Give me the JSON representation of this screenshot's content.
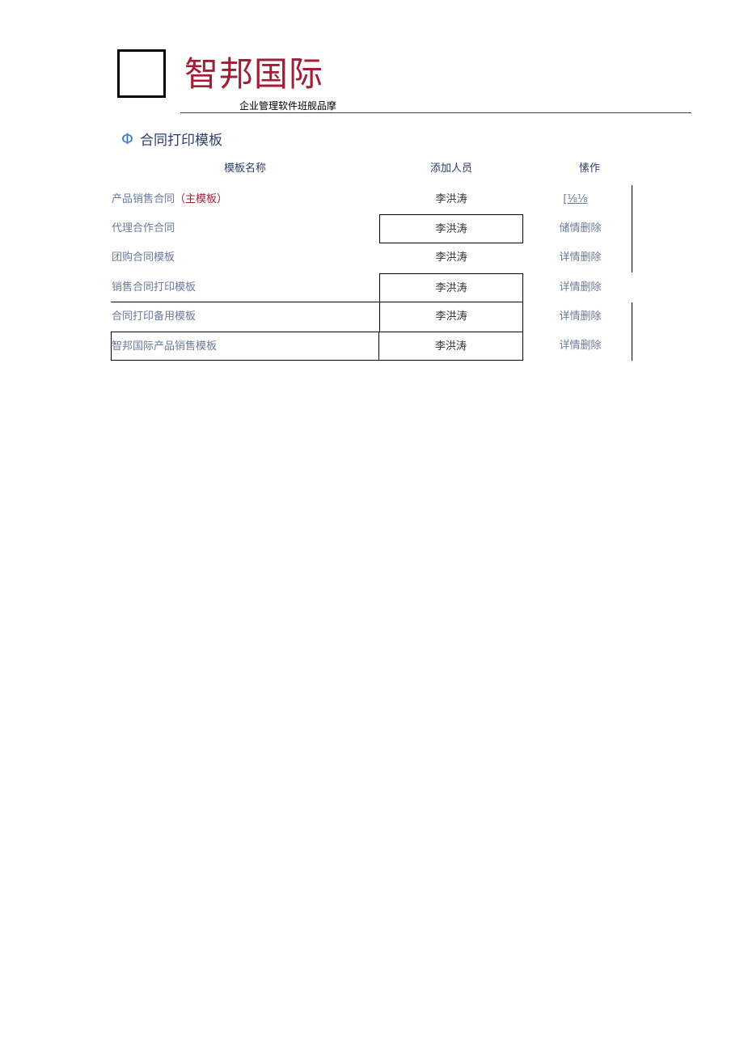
{
  "header": {
    "brand": "智邦国际",
    "tagline": "企业管理软件班舰品摩"
  },
  "section": {
    "icon": "Φ",
    "title": "合同打印模板"
  },
  "table": {
    "columns": [
      "模板名称",
      "添加人员",
      "愫作"
    ],
    "rows": [
      {
        "name": "产品销售合同",
        "tag": "（主模板）",
        "user": "李洪涛",
        "ops": "[⅛⅛"
      },
      {
        "name": "代理合作合同",
        "tag": "",
        "user": "李洪涛",
        "ops": "储情删除"
      },
      {
        "name": "团购合同模板",
        "tag": "",
        "user": "李洪涛",
        "ops": "详情删除"
      },
      {
        "name": "销售合同打印模板",
        "tag": "",
        "user": "李洪涛",
        "ops": "详情删除"
      },
      {
        "name": "合同打印备用模板",
        "tag": "",
        "user": "李洪涛",
        "ops": "详情删除"
      },
      {
        "name": "智邦国际产品销售模板",
        "tag": "",
        "user": "李洪涛",
        "ops": "详情删除"
      }
    ]
  },
  "colors": {
    "brand": "#a11f36",
    "heading": "#2d3e6e",
    "muted_link": "#6b7a99",
    "icon": "#3a7fc4"
  }
}
